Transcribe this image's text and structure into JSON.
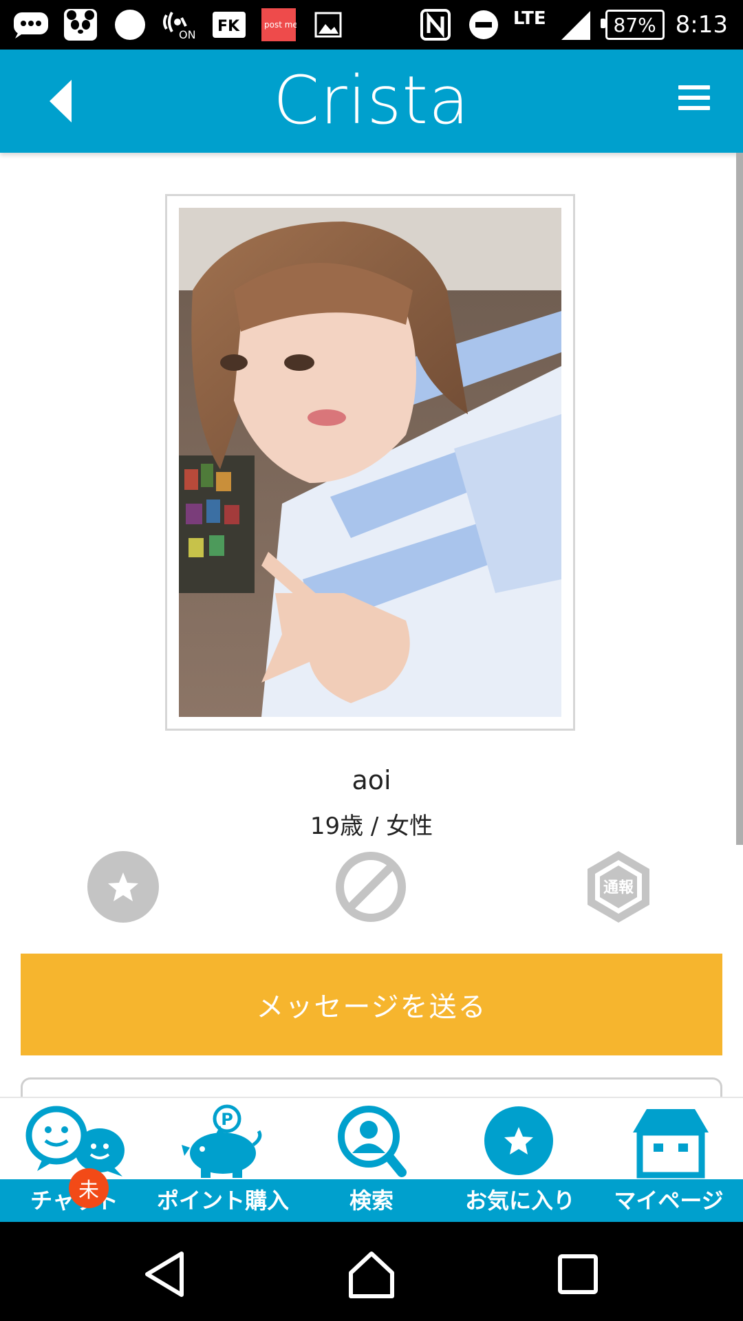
{
  "status_bar": {
    "notification_icons": [
      "chat-bubble-icon",
      "panda-icon",
      "circle-icon",
      "nfc-on-icon",
      "fk-icon",
      "postme-icon",
      "image-icon"
    ],
    "fk_label": "FK",
    "postme_label": "post me",
    "nfc_on_label": "ON",
    "network": "LTE",
    "battery": "87%",
    "time": "8:13"
  },
  "header": {
    "title": "Crista"
  },
  "profile": {
    "name": "aoi",
    "age_gender": "19歳 / 女性"
  },
  "actions": {
    "report_label": "通報"
  },
  "message_button": {
    "label": "メッセージを送る"
  },
  "bottom_nav": {
    "items": [
      {
        "label": "チャット",
        "icon": "chat-icon",
        "badge": "未"
      },
      {
        "label": "ポイント購入",
        "icon": "piggy-bank-icon"
      },
      {
        "label": "検索",
        "icon": "search-user-icon"
      },
      {
        "label": "お気に入り",
        "icon": "star-icon"
      },
      {
        "label": "マイページ",
        "icon": "house-icon"
      }
    ]
  },
  "colors": {
    "brand": "#00a0cd",
    "message_button": "#f6b52e",
    "badge": "#f24a17",
    "action_icon_gray": "#c4c4c4"
  }
}
